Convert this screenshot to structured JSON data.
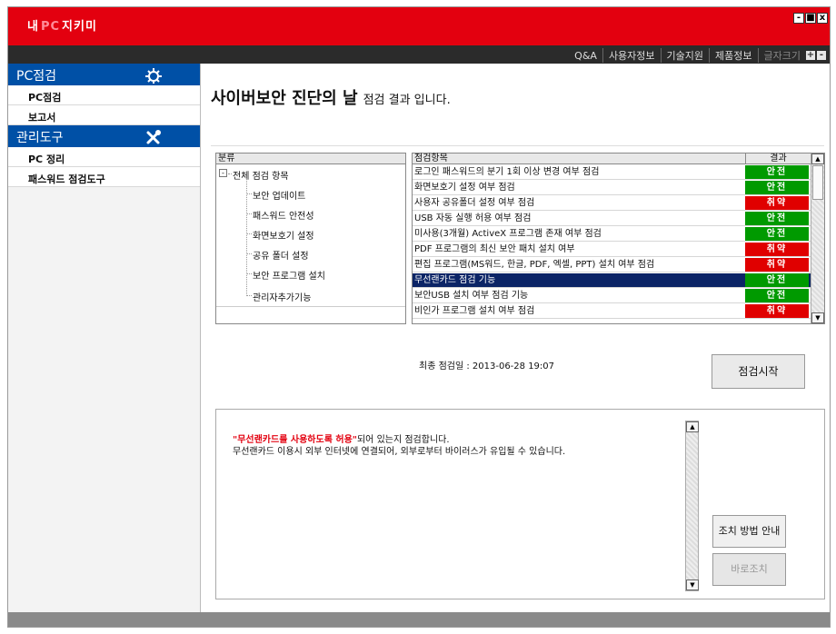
{
  "window": {
    "title_pre": "내",
    "title_pc": "PC",
    "title_post": "지키미",
    "btn_min": "-",
    "btn_max": "■",
    "btn_close": "x"
  },
  "topnav": {
    "items": [
      "Q&A",
      "사용자정보",
      "기술지원",
      "제품정보"
    ],
    "font_size_label": "글자크기",
    "plus": "+",
    "minus": "-"
  },
  "sidebar": {
    "sections": [
      {
        "label": "PC점검",
        "icon": "gear-icon",
        "items": [
          "PC점검",
          "보고서"
        ]
      },
      {
        "label": "관리도구",
        "icon": "tools-icon",
        "items": [
          "PC 정리",
          "패스워드 점검도구"
        ]
      }
    ]
  },
  "main": {
    "heading_big": "사이버보안 진단의 날",
    "heading_small": "점검 결과 입니다."
  },
  "tree": {
    "header": "분류",
    "root": "전체 점검 항목",
    "toggle": "-",
    "children": [
      "보안 업데이트",
      "패스워드 안전성",
      "화면보호기 설정",
      "공유 폴더 설정",
      "보안 프로그램 설치",
      "관리자추가기능"
    ]
  },
  "grid": {
    "header_item": "점검항목",
    "header_result": "결과",
    "scroll_up": "▲",
    "scroll_down": "▼",
    "rows": [
      {
        "item": "로그인 패스워드의 분기 1회 이상 변경 여부 점검",
        "result": "안전"
      },
      {
        "item": "화면보호기 설정 여부 점검",
        "result": "안전"
      },
      {
        "item": "사용자 공유폴더 설정 여부 점검",
        "result": "취약"
      },
      {
        "item": "USB 자동 실행 허용 여부 점검",
        "result": "안전"
      },
      {
        "item": "미사용(3개월) ActiveX 프로그램 존재 여부 점검",
        "result": "안전"
      },
      {
        "item": "PDF 프로그램의 최신 보안 패치 설치 여부",
        "result": "취약"
      },
      {
        "item": "편집 프로그램(MS워드, 한글, PDF, 엑셀, PPT) 설치 여부 점검",
        "result": "취약"
      },
      {
        "item": "무선랜카드 점검 기능",
        "result": "안전"
      },
      {
        "item": "보안USB 설치 여부 점검 기능",
        "result": "안전"
      },
      {
        "item": "비인가 프로그램 설치 여부 점검",
        "result": "취약"
      }
    ],
    "selected_index": 7
  },
  "last_check": "최종 점검일 : 2013-06-28 19:07",
  "start_button": "점검시작",
  "info": {
    "highlight": "\"무선랜카드를 사용하도록 허용\"",
    "line1_rest": "되어 있는지 점검합니다.",
    "line2": "무선랜카드 이용시 외부 인터넷에 연결되어, 외부로부터 바이러스가 유입될 수 있습니다.",
    "scroll_up": "▲",
    "scroll_down": "▼"
  },
  "buttons": {
    "guide": "조치 방법 안내",
    "fix": "바로조치"
  },
  "colors": {
    "titlebar": "#e3000f",
    "sidebar_section": "#0050a6",
    "safe": "#009a00",
    "vulnerable": "#e00000",
    "selected_row": "#0b2466"
  }
}
